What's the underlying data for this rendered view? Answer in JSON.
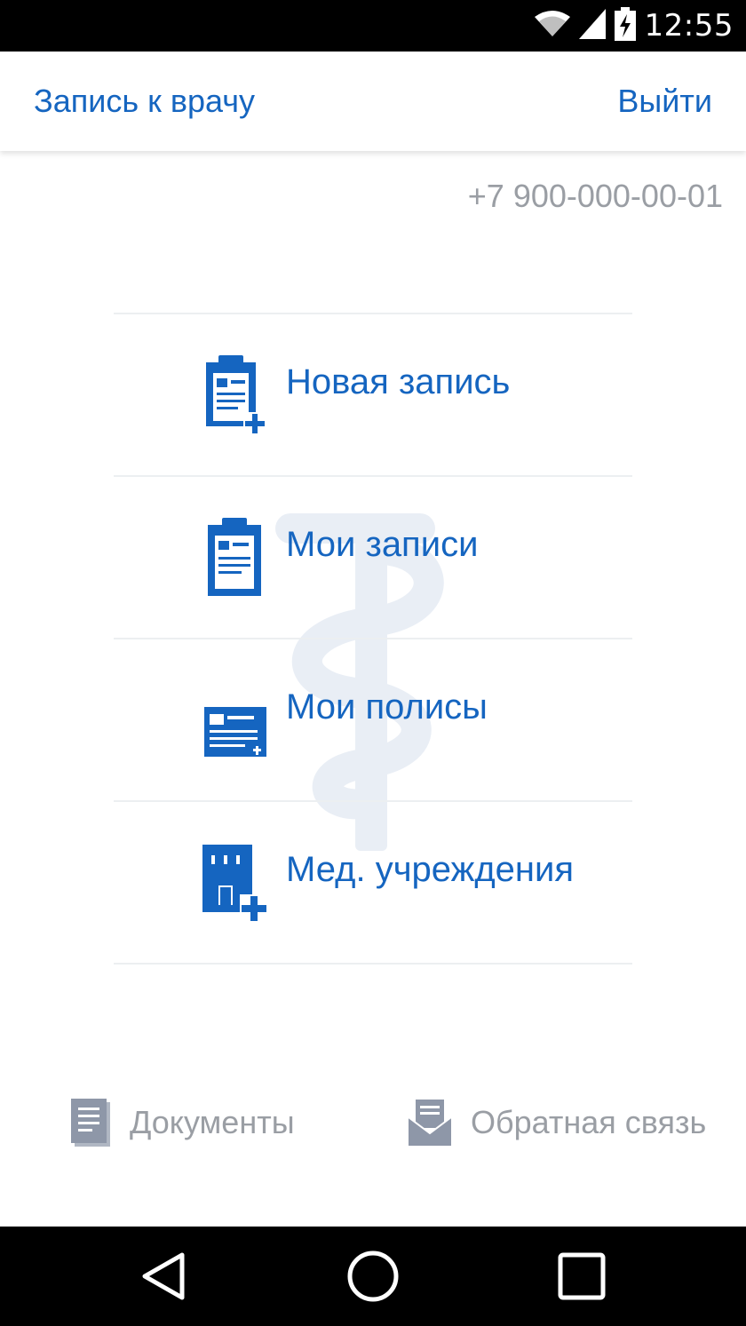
{
  "status_bar": {
    "time": "12:55",
    "icons": [
      "wifi-icon",
      "cell-signal-icon",
      "battery-charging-icon"
    ]
  },
  "app_bar": {
    "title": "Запись к врачу",
    "logout_label": "Выйти"
  },
  "account": {
    "phone": "+7 900-000-00-01"
  },
  "menu": {
    "items": [
      {
        "label": "Новая запись",
        "icon": "clipboard-plus-icon"
      },
      {
        "label": "Мои записи",
        "icon": "clipboard-icon"
      },
      {
        "label": "Мои полисы",
        "icon": "policy-card-icon"
      },
      {
        "label": "Мед. учреждения",
        "icon": "hospital-building-icon"
      }
    ]
  },
  "footer": {
    "documents_label": "Документы",
    "feedback_label": "Обратная связь"
  },
  "nav_bar": {
    "buttons": [
      "back-icon",
      "home-icon",
      "recents-icon"
    ]
  },
  "colors": {
    "accent": "#1565c0",
    "muted_text": "#9a9ea4",
    "divider": "#eceff1",
    "watermark": "#e9eef5",
    "footer_icon": "#8e97a8"
  }
}
